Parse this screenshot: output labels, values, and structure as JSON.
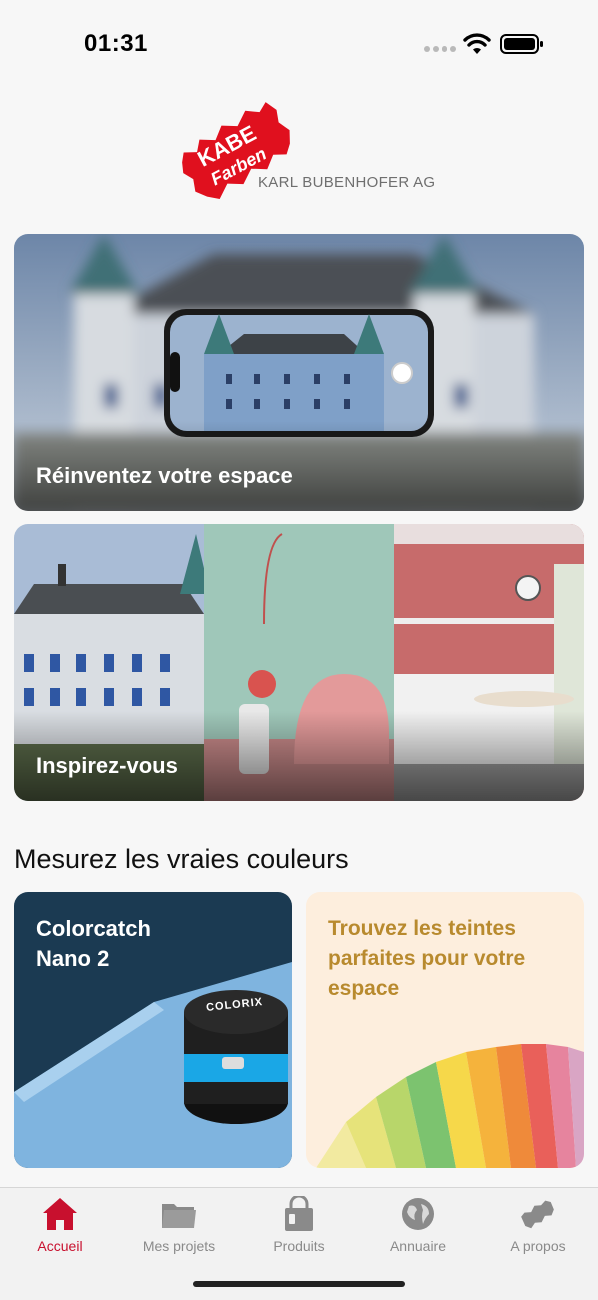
{
  "status_bar": {
    "time": "01:31"
  },
  "header": {
    "logo_line1": "KABE",
    "logo_line2": "Farben",
    "company_name": "KARL BUBENHOFER AG"
  },
  "hero_cards": {
    "reinvent_label": "Réinventez votre espace",
    "inspire_label": "Inspirez-vous"
  },
  "measure_section": {
    "heading": "Mesurez les vraies couleurs",
    "nano_title_line1": "Colorcatch",
    "nano_title_line2": "Nano 2",
    "device_brand": "COLORIX",
    "shades_title": "Trouvez les teintes parfaites pour votre espace"
  },
  "tab_bar": {
    "tabs": [
      {
        "label": "Accueil",
        "icon": "home-icon",
        "active": true
      },
      {
        "label": "Mes projets",
        "icon": "folder-icon",
        "active": false
      },
      {
        "label": "Produits",
        "icon": "paint-bucket-icon",
        "active": false
      },
      {
        "label": "Annuaire",
        "icon": "globe-icon",
        "active": false
      },
      {
        "label": "A propos",
        "icon": "kabe-logo-icon",
        "active": false
      }
    ]
  },
  "colors": {
    "accent": "#c8102e",
    "nano_card_bg": "#1b3a52",
    "shades_card_bg": "#fdeedd",
    "shades_title": "#b88a2e"
  }
}
